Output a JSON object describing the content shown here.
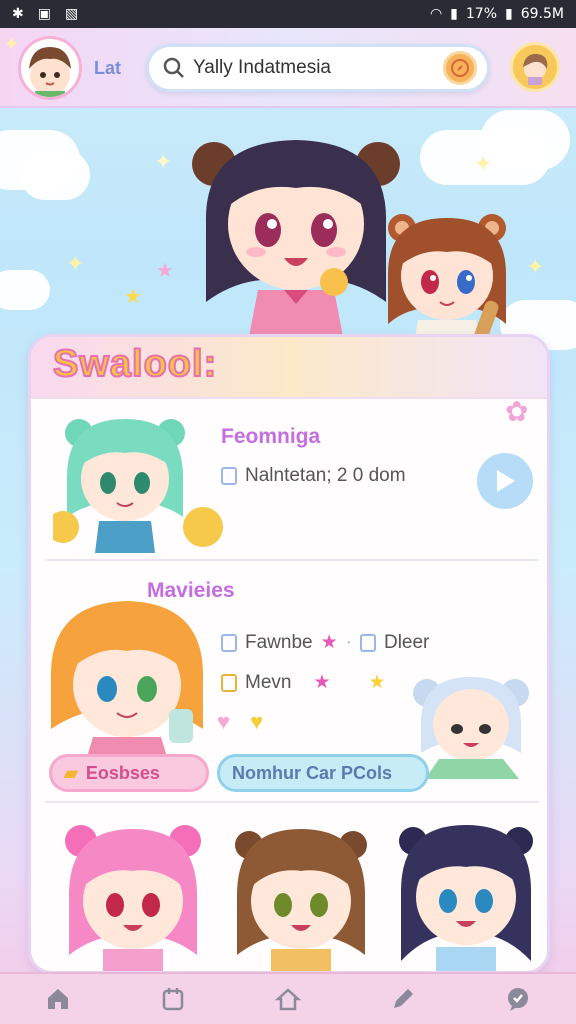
{
  "status": {
    "battery": "17%",
    "data": "69.5M"
  },
  "appbar": {
    "label": "Lat",
    "search_value": "Yally Indatmesia"
  },
  "card": {
    "title": "Swalool:",
    "section1": {
      "heading": "Feomniga",
      "line": "Nalntetan; 2 0 dom"
    },
    "section2": {
      "heading": "Mavieies",
      "line1": "Fawnbe",
      "line1b": "Dleer",
      "line2": "Mevn"
    },
    "pills": {
      "pink": "Eosbses",
      "blue": "Nomhur Car PCols"
    }
  },
  "nav": {
    "items": [
      "home-icon",
      "calendar-icon",
      "house-icon",
      "edit-icon",
      "chat-icon"
    ]
  },
  "colors": {
    "accent_pink": "#e86fb5",
    "accent_gold": "#f6c443",
    "heading_purple": "#c46ee0"
  }
}
